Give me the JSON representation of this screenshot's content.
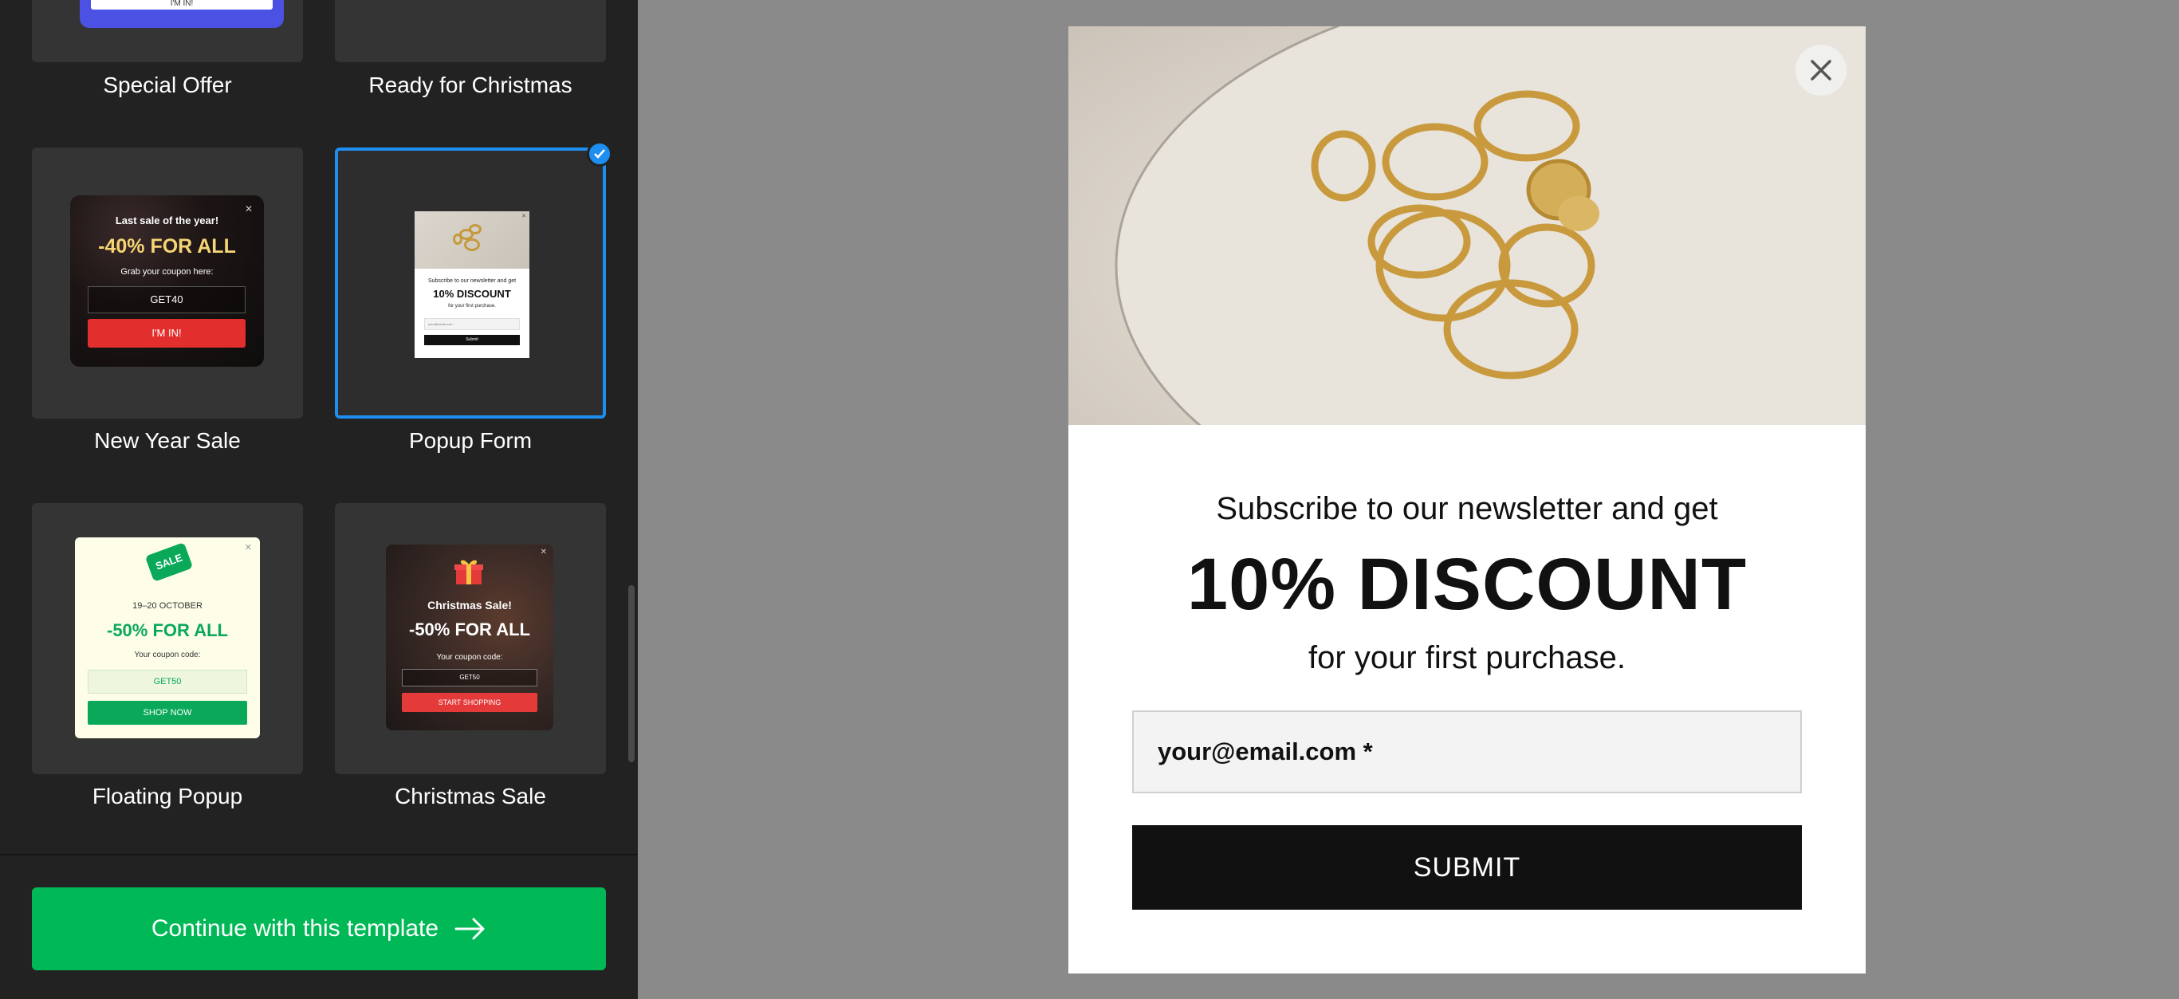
{
  "sidebar": {
    "templates": [
      {
        "label": "Special Offer",
        "thumb": {
          "button": "I'M IN!"
        }
      },
      {
        "label": "Ready for Christmas"
      },
      {
        "label": "New Year Sale",
        "selected": false,
        "thumb": {
          "title": "Last sale of the year!",
          "offer": "-40% FOR ALL",
          "subtitle": "Grab your coupon here:",
          "code": "GET40",
          "button": "I'M IN!"
        }
      },
      {
        "label": "Popup Form",
        "selected": true,
        "thumb": {
          "pre": "Subscribe to our newsletter and get",
          "headline": "10% DISCOUNT",
          "post": "for your first purchase.",
          "input": "your@email.com *",
          "button": "Submit"
        }
      },
      {
        "label": "Floating Popup",
        "thumb": {
          "tag": "SALE",
          "dates": "19–20 OCTOBER",
          "offer": "-50% FOR ALL",
          "subtitle": "Your coupon code:",
          "code": "GET50",
          "button": "SHOP NOW"
        }
      },
      {
        "label": "Christmas Sale",
        "thumb": {
          "title": "Christmas Sale!",
          "offer": "-50% FOR ALL",
          "subtitle": "Your coupon code:",
          "code": "GET50",
          "button": "START SHOPPING"
        }
      }
    ],
    "continue_label": "Continue with this template",
    "icons": {
      "selected": "check-icon",
      "continue": "arrow-right-icon",
      "close": "close-icon",
      "gift": "gift-icon"
    }
  },
  "popup": {
    "pre_headline": "Subscribe to our newsletter and get",
    "headline": "10% DISCOUNT",
    "post_headline": "for your first purchase.",
    "email_placeholder": "your@email.com *",
    "submit_label": "SUBMIT"
  },
  "colors": {
    "sidebar_bg": "#222222",
    "card_bg": "#343434",
    "selection_blue": "#1e8ef0",
    "continue_green": "#00b956",
    "canvas_gray": "#8a8a8a",
    "submit_black": "#111111"
  }
}
